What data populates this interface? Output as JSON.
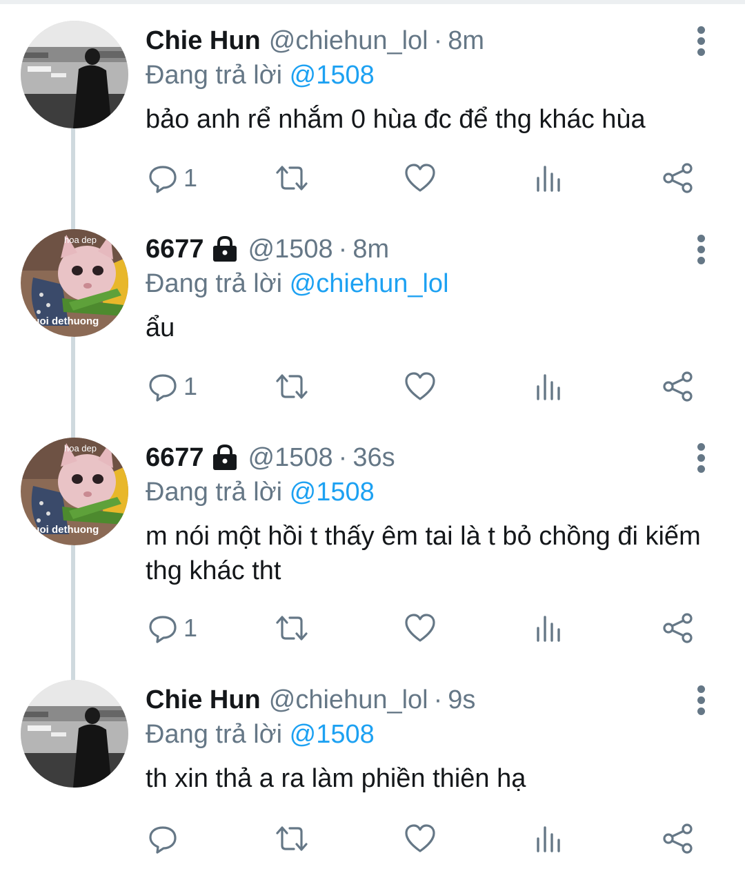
{
  "tweets": [
    {
      "name": "Chie Hun",
      "handle": "@chiehun_lol",
      "sep": "·",
      "time": "8m",
      "locked": false,
      "avatar": "man-street-photo-avatar",
      "reply_prefix": "Đang trả lời",
      "reply_to": "@1508",
      "text": "bảo anh rể nhắm 0 hùa đc để thg khác hùa",
      "reply_count": "1"
    },
    {
      "name": "6677",
      "handle": "@1508",
      "sep": "·",
      "time": "8m",
      "locked": true,
      "avatar": "hairless-cat-flowers-avatar",
      "avatar_caption_top": "hoa dep",
      "avatar_caption_bottom": "nguoi dethuong",
      "reply_prefix": "Đang trả lời",
      "reply_to": "@chiehun_lol",
      "text": "ẩu",
      "reply_count": "1"
    },
    {
      "name": "6677",
      "handle": "@1508",
      "sep": "·",
      "time": "36s",
      "locked": true,
      "avatar": "hairless-cat-flowers-avatar",
      "avatar_caption_top": "hoa dep",
      "avatar_caption_bottom": "nguoi dethuong",
      "reply_prefix": "Đang trả lời",
      "reply_to": "@1508",
      "text": "m nói một hồi t thấy êm tai là t bỏ chồng đi kiếm thg khác tht",
      "reply_count": "1"
    },
    {
      "name": "Chie Hun",
      "handle": "@chiehun_lol",
      "sep": "·",
      "time": "9s",
      "locked": false,
      "avatar": "man-street-photo-avatar",
      "reply_prefix": "Đang trả lời",
      "reply_to": "@1508",
      "text": "th xin thả a ra làm phiền thiên hạ",
      "reply_count": ""
    }
  ],
  "icons": {
    "reply": "comment-icon",
    "retweet": "retweet-icon",
    "like": "heart-icon",
    "analytics": "analytics-icon",
    "share": "share-icon",
    "more": "more-vertical-icon",
    "lock": "lock-icon"
  },
  "colors": {
    "text": "#14171a",
    "secondary": "#657786",
    "link": "#1da1f2",
    "thread_line": "#cfd9de"
  }
}
